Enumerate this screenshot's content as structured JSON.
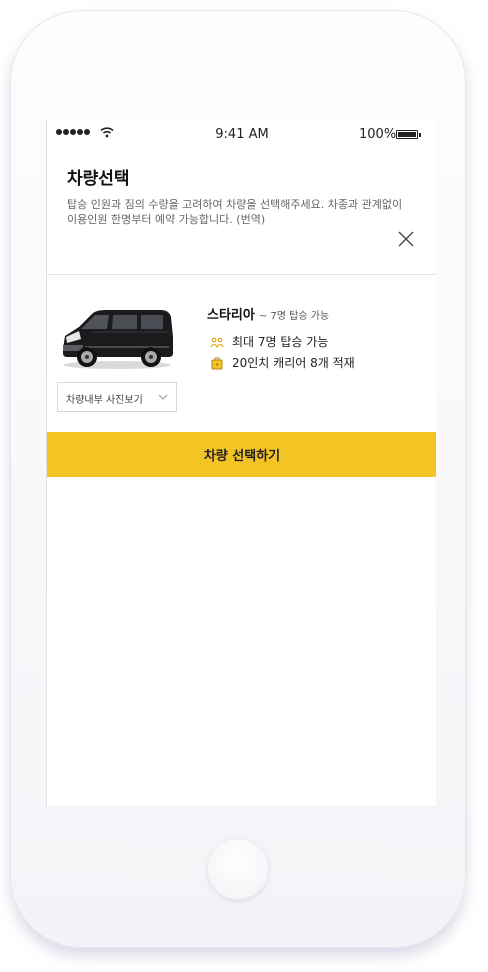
{
  "status_bar": {
    "time": "9:41 AM",
    "battery_percent": "100%",
    "signal_icon": "signal-dots-icon",
    "wifi_icon": "wifi-icon",
    "battery_icon": "battery-icon"
  },
  "header": {
    "title": "차량선택",
    "description": "탑승 인원과 짐의 수량을 고려하여 차량을 선택해주세요. 차종과 관계없이 이용인원 한명부터 예약 가능합니다. (번역)",
    "close_icon": "close-icon"
  },
  "vehicle": {
    "name": "스타리아",
    "capacity_caption": "~ 7명 탑승 가능",
    "image_icon": "van-image",
    "features": [
      {
        "icon": "passengers-icon",
        "label": "최대 7명 탑승 가능"
      },
      {
        "icon": "luggage-icon",
        "label": "20인치 캐리어 8개 적재"
      }
    ],
    "photo_dropdown": {
      "selected": "차량내부 사진보기",
      "icon": "chevron-down-icon"
    }
  },
  "actions": {
    "select_label": "차량 선택하기"
  },
  "colors": {
    "accent": "#f3c423",
    "icon_accent": "#e2a81e"
  }
}
